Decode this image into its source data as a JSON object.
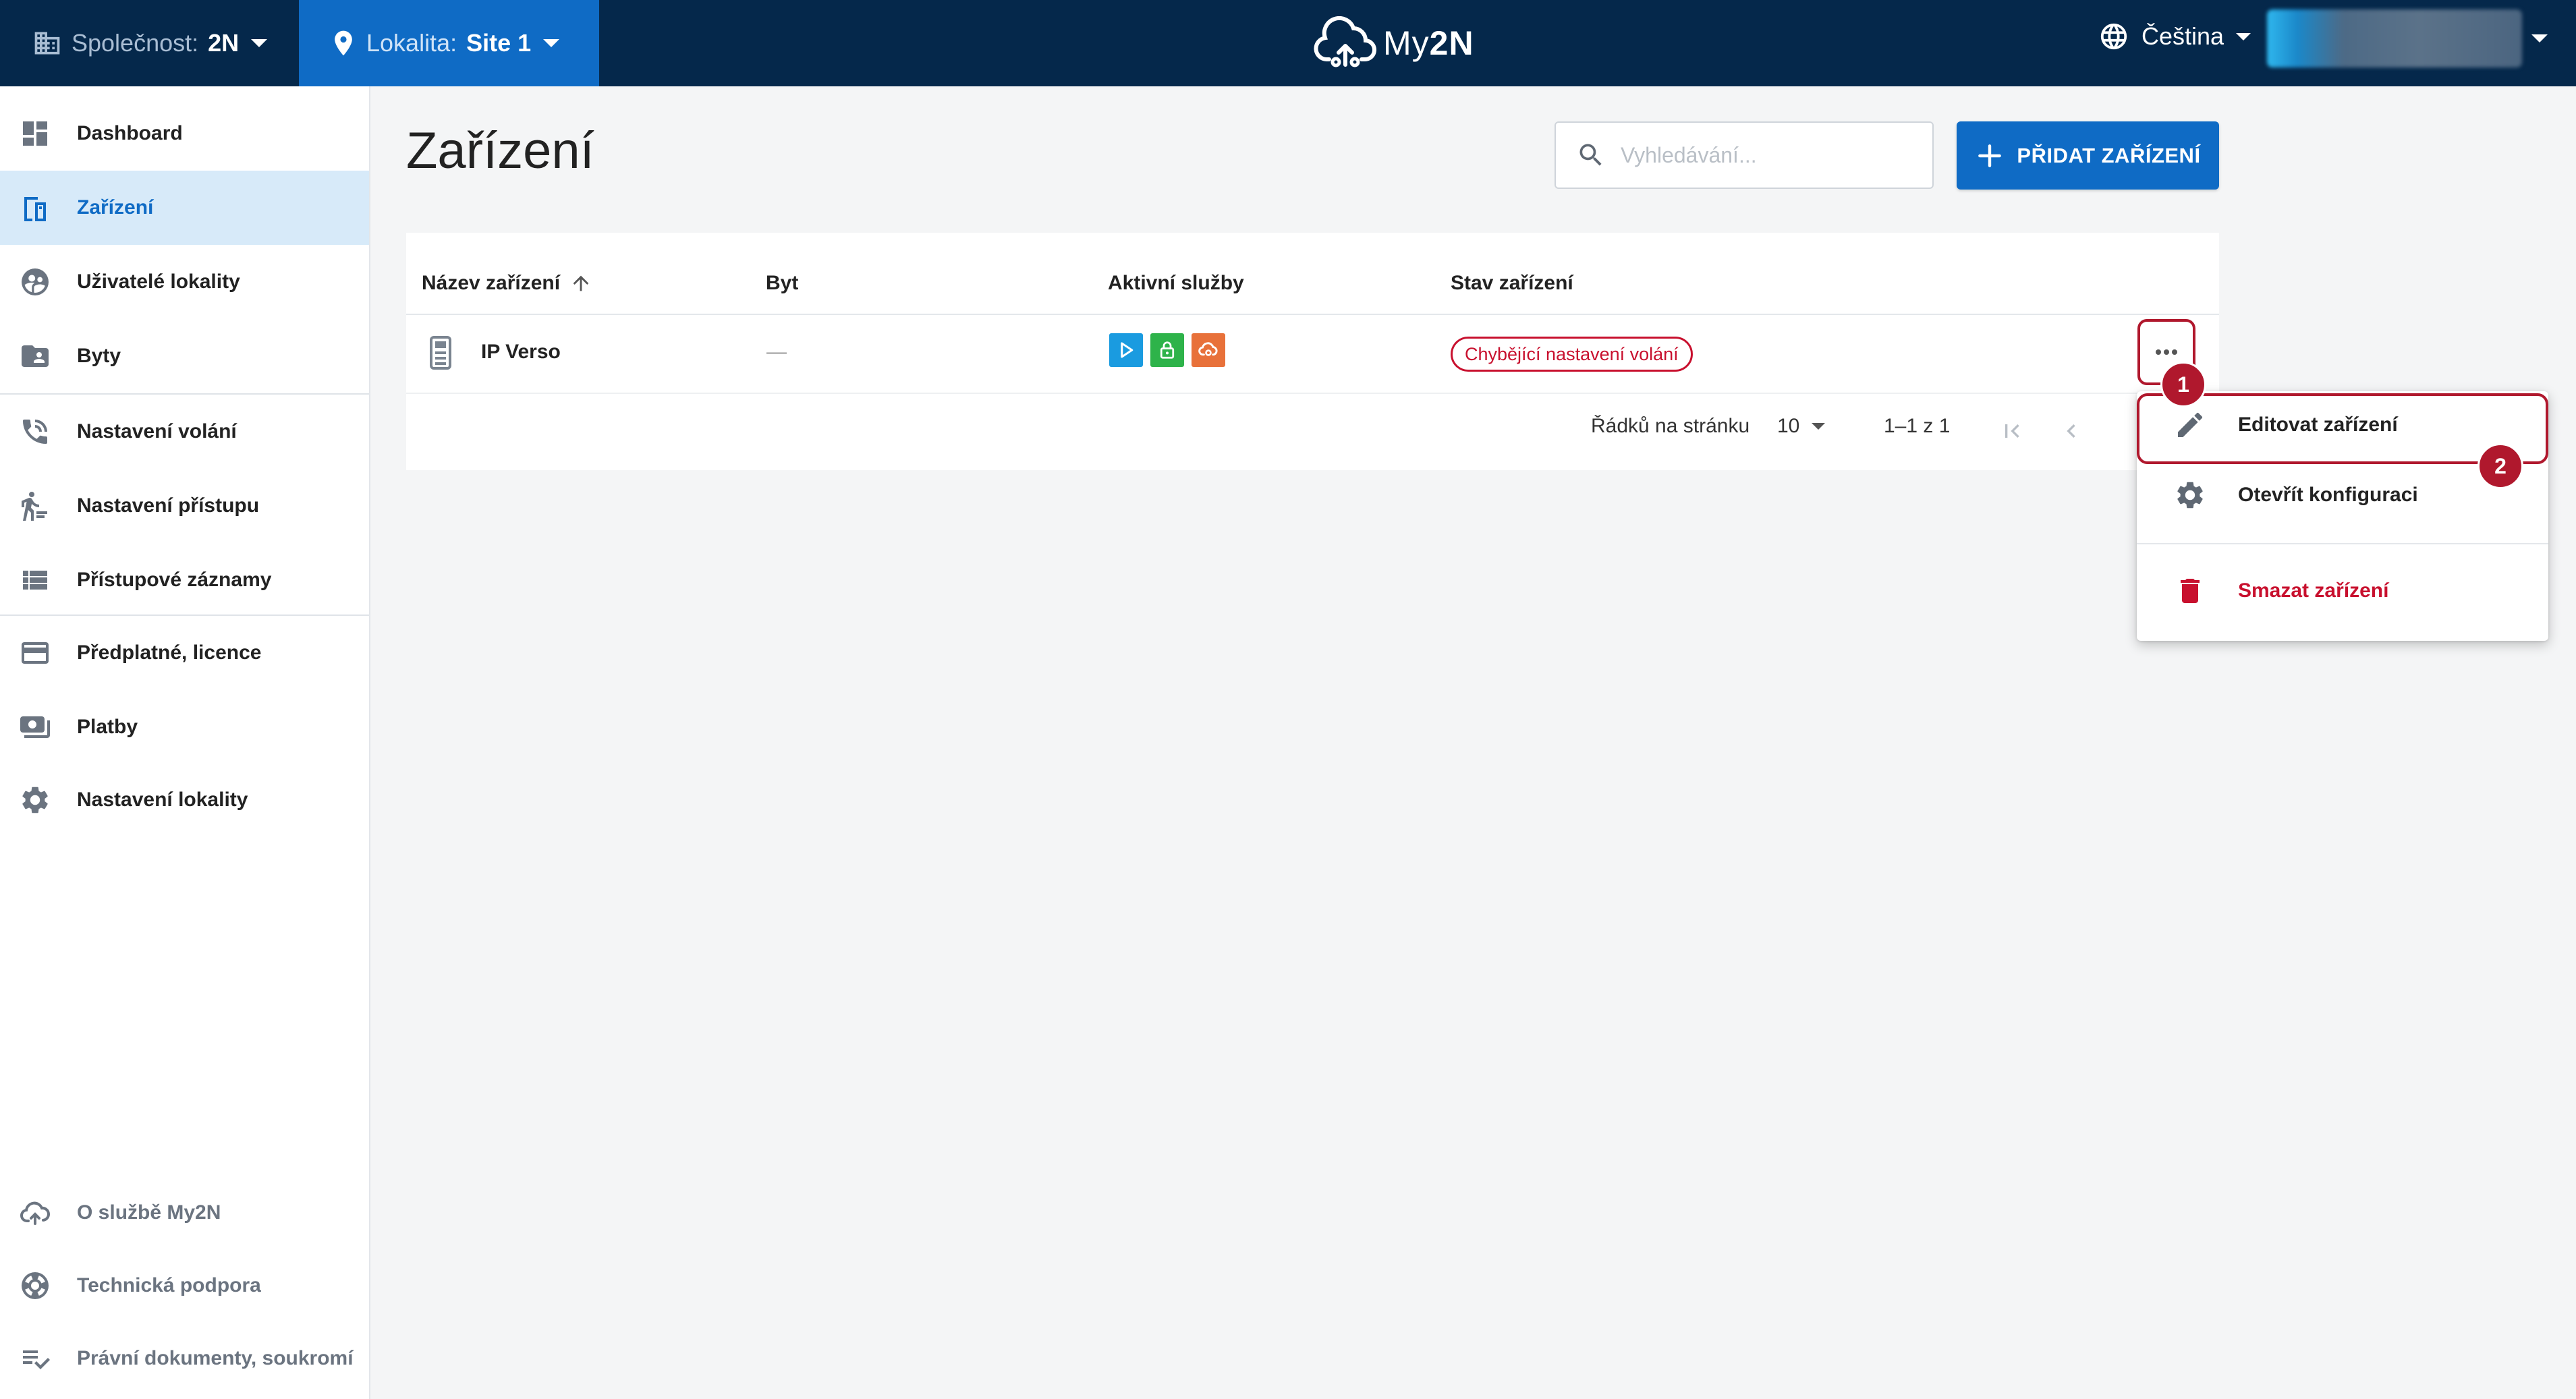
{
  "topbar": {
    "company_label": "Společnost:",
    "company_value": "2N",
    "site_label": "Lokalita:",
    "site_value": "Site 1",
    "logo_prefix": "My",
    "logo_suffix": "2N",
    "language": "Čeština"
  },
  "sidebar": {
    "items": [
      {
        "label": "Dashboard",
        "icon": "dashboard-icon"
      },
      {
        "label": "Zařízení",
        "icon": "device-icon"
      },
      {
        "label": "Uživatelé lokality",
        "icon": "users-icon"
      },
      {
        "label": "Byty",
        "icon": "apartments-icon"
      },
      {
        "label": "Nastavení volání",
        "icon": "phone-settings-icon"
      },
      {
        "label": "Nastavení přístupu",
        "icon": "access-icon"
      },
      {
        "label": "Přístupové záznamy",
        "icon": "access-log-icon"
      },
      {
        "label": "Předplatné, licence",
        "icon": "credit-card-icon"
      },
      {
        "label": "Platby",
        "icon": "payments-icon"
      },
      {
        "label": "Nastavení lokality",
        "icon": "gear-icon"
      }
    ],
    "footer": [
      {
        "label": "O službě My2N",
        "icon": "cloud-icon"
      },
      {
        "label": "Technická podpora",
        "icon": "support-icon"
      },
      {
        "label": "Právní dokumenty, soukromí",
        "icon": "legal-icon"
      }
    ]
  },
  "main": {
    "title": "Zařízení",
    "search_placeholder": "Vyhledávání...",
    "add_button": "PŘIDAT ZAŘÍZENÍ"
  },
  "table": {
    "columns": [
      "Název zařízení",
      "Byt",
      "Aktivní služby",
      "Stav zařízení"
    ],
    "rows": [
      {
        "name": "IP Verso",
        "apartment": "—",
        "services": [
          "mobile-video",
          "access-control",
          "remote-configuration"
        ],
        "status": "Chybějící nastavení volání"
      }
    ],
    "rows_per_page_label": "Řádků na stránku",
    "rows_per_page": "10",
    "range": "1–1 z 1"
  },
  "menu": {
    "items": [
      {
        "label": "Editovat zařízení",
        "icon": "pencil-icon"
      },
      {
        "label": "Otevřít konfiguraci",
        "icon": "gear-icon"
      },
      {
        "label": "Smazat zařízení",
        "icon": "trash-icon"
      }
    ]
  },
  "annotations": [
    "1",
    "2"
  ],
  "colors": {
    "topbar": "#05284b",
    "accent": "#0f6bc5",
    "danger": "#c8102e",
    "svc_video": "#1a9be0",
    "svc_access": "#2eb34a",
    "svc_cloud": "#e8713a"
  }
}
